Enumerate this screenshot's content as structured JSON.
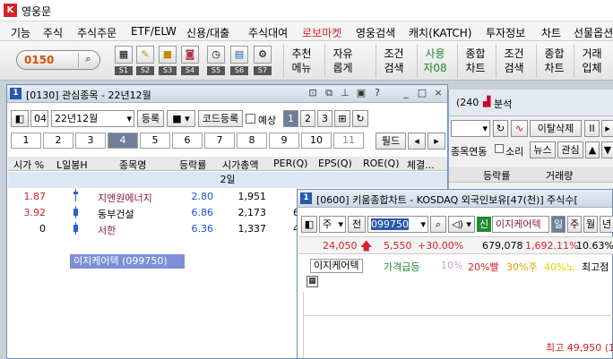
{
  "app": {
    "title": "영웅문"
  },
  "menu": [
    "기능",
    "주식",
    "주식주문",
    "ETF/ELW",
    "신용/대출",
    "주식대여",
    "로보마켓",
    "영웅검색",
    "캐치(KATCH)",
    "투자정보",
    "차트",
    "선물옵션"
  ],
  "colors": {
    "robo_menu": "#d6222b",
    "accent": "#2a59a8",
    "up": "#d6222b",
    "down": "#1f4fd6"
  },
  "toolbar": {
    "account": "0150",
    "shortcuts": [
      {
        "caption": "S1",
        "icon": "calc-icon"
      },
      {
        "caption": "S2",
        "icon": "pencil-icon"
      },
      {
        "caption": "S3",
        "icon": "lock-icon"
      },
      {
        "caption": "S4",
        "icon": "camera-icon"
      },
      {
        "caption": "S5",
        "icon": "clock-icon"
      },
      {
        "caption": "S6",
        "icon": "grid-icon"
      },
      {
        "caption": "S7",
        "icon": "gear-icon"
      }
    ],
    "big": [
      {
        "l1": "추천",
        "l2": "메뉴"
      },
      {
        "l1": "자유",
        "l2": "롭게"
      },
      {
        "l1": "조건",
        "l2": "검색"
      },
      {
        "l1": "사용",
        "l2": "자08"
      },
      {
        "l1": "종합",
        "l2": "차트"
      },
      {
        "l1": "조건",
        "l2": "검색"
      },
      {
        "l1": "종합",
        "l2": "차트"
      },
      {
        "l1": "거래",
        "l2": "입체"
      }
    ]
  },
  "watchlist": {
    "title": "[0130] 관심종목 - 22년12월",
    "group_code": "04",
    "group_name": "22년12월",
    "register": "등록",
    "code_register": "코드등록",
    "forecast": "예상",
    "pages": [
      "1",
      "2",
      "3"
    ],
    "tabs": [
      "1",
      "2",
      "3",
      "4",
      "5",
      "6",
      "7",
      "8",
      "9",
      "10",
      "11"
    ],
    "selected_tab": "4",
    "field": "필드",
    "columns": [
      "시가 %",
      "L일봉H",
      "종목명",
      "등락률",
      "시가총액",
      "PER(Q)",
      "EPS(Q)",
      "ROE(Q)",
      "체결..."
    ],
    "group_label": "2일",
    "rows": [
      {
        "open": "1.87",
        "name": "지엔원에너지",
        "change": "2.80",
        "mcap": "1,951",
        "per": ""
      },
      {
        "open": "3.92",
        "name": "동부건설",
        "change": "6.86",
        "mcap": "2,173",
        "per": "6"
      },
      {
        "open": "0",
        "name": "서한",
        "change": "6.36",
        "mcap": "1,337",
        "per": "4"
      }
    ],
    "tooltip": "이지케어텍 (099750)"
  },
  "bgwin": {
    "title": "(240",
    "tab2": "분석",
    "btn_delete": "이탈삭제",
    "chk_link": "종목연동",
    "chk_sound": "소리",
    "btn_news": "뉴스",
    "btn_interest": "관심",
    "col_change": "등락률",
    "col_volume": "거래량"
  },
  "chart": {
    "title": "[0600] 키움종합차트 - KOSDAQ 외국인보유[47(천)] 주식수[",
    "stock_type": "주",
    "all": "전",
    "code": "099750",
    "badge": "신",
    "name": "이지케어텍",
    "periods": [
      "일",
      "주",
      "월",
      "년"
    ],
    "price": "24,050",
    "change": "5,550",
    "change_pct": "+30.00%",
    "volume": "679,078",
    "vol_ratio": "1,692.11%",
    "turnover": "10.63%",
    "legend_name": "이지케어텍",
    "indicator": "가격급등",
    "l10": "10%",
    "l20": "20%빨",
    "l30": "30%주",
    "l40": "40%노",
    "high_label": "최고점",
    "high_value": "최고 49,950 (10/"
  }
}
